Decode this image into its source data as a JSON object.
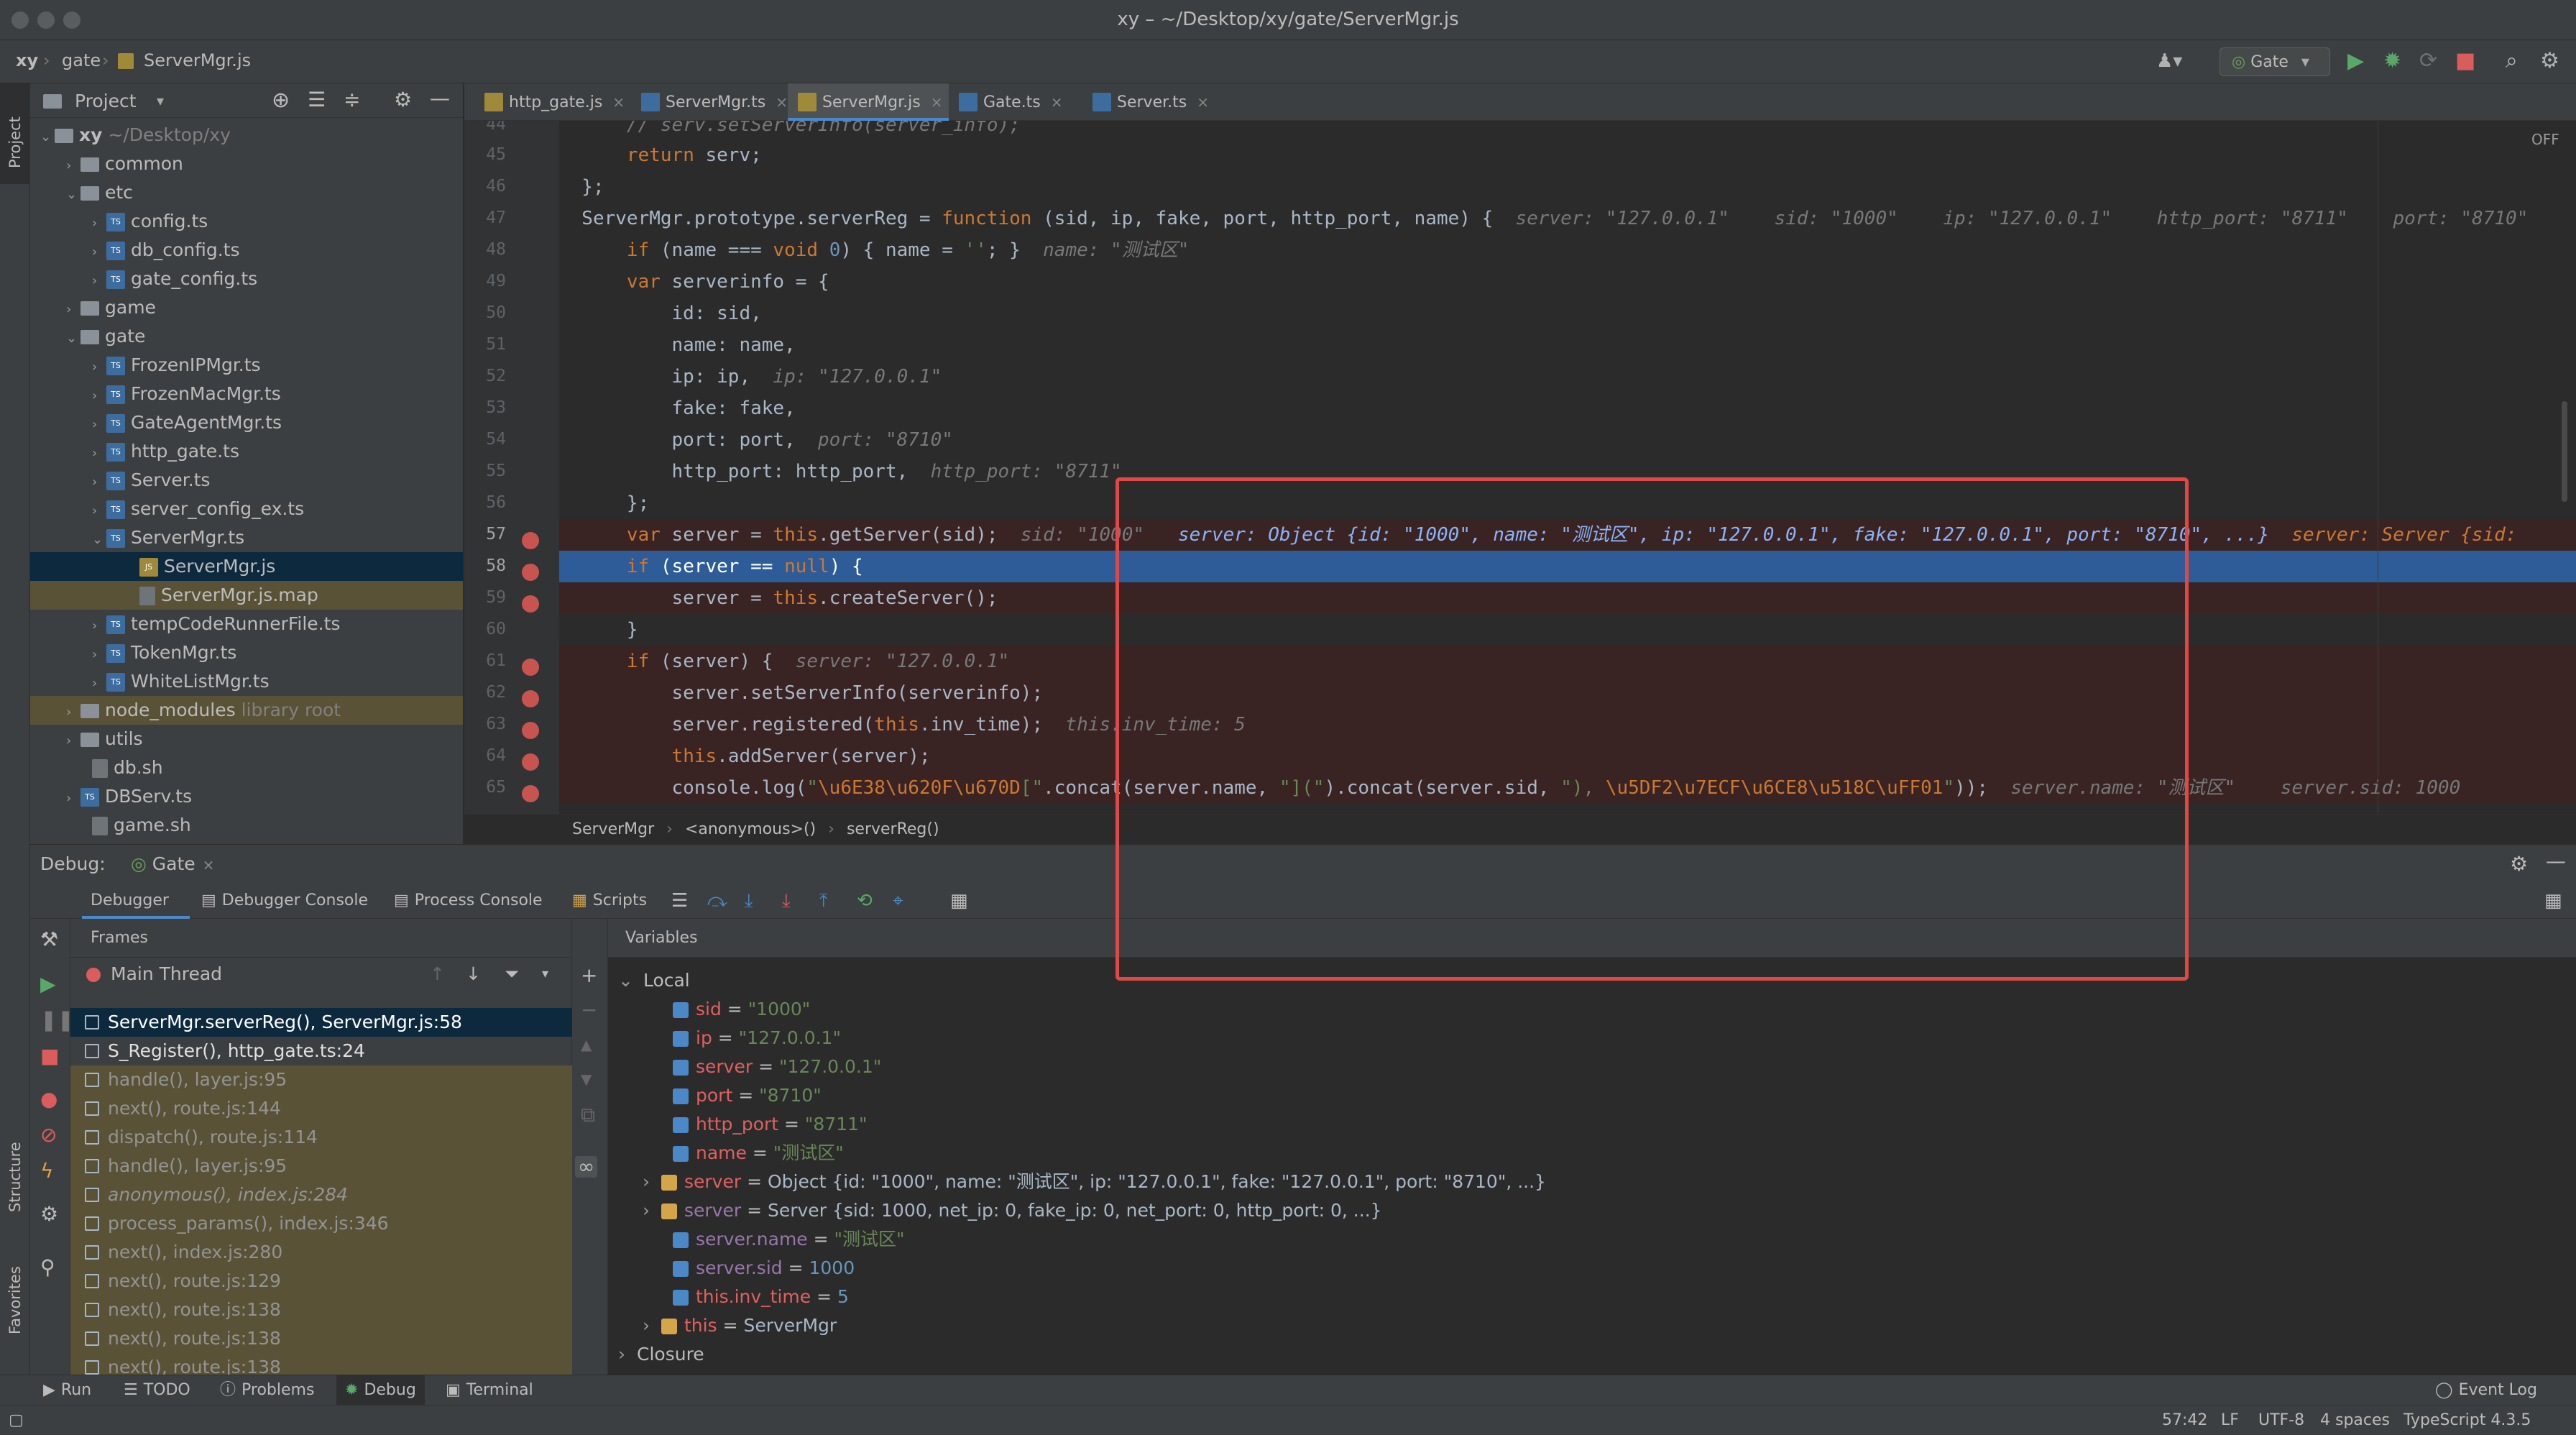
{
  "window": {
    "title": "xy – ~/Desktop/xy/gate/ServerMgr.js"
  },
  "nav": {
    "crumbs": [
      "xy",
      "gate",
      "ServerMgr.js"
    ],
    "run_config": "Gate"
  },
  "left_stripe": {
    "project": "Project",
    "structure": "Structure",
    "favorites": "Favorites"
  },
  "project": {
    "title": "Project",
    "rows": [
      {
        "label": "xy",
        "hint": "~/Desktop/xy"
      },
      {
        "label": "common"
      },
      {
        "label": "etc"
      },
      {
        "label": "config.ts"
      },
      {
        "label": "db_config.ts"
      },
      {
        "label": "gate_config.ts"
      },
      {
        "label": "game"
      },
      {
        "label": "gate"
      },
      {
        "label": "FrozenIPMgr.ts"
      },
      {
        "label": "FrozenMacMgr.ts"
      },
      {
        "label": "GateAgentMgr.ts"
      },
      {
        "label": "http_gate.ts"
      },
      {
        "label": "Server.ts"
      },
      {
        "label": "server_config_ex.ts"
      },
      {
        "label": "ServerMgr.ts"
      },
      {
        "label": "ServerMgr.js"
      },
      {
        "label": "ServerMgr.js.map"
      },
      {
        "label": "tempCodeRunnerFile.ts"
      },
      {
        "label": "TokenMgr.ts"
      },
      {
        "label": "WhiteListMgr.ts"
      },
      {
        "label": "node_modules",
        "hint": "library root"
      },
      {
        "label": "utils"
      },
      {
        "label": "db.sh"
      },
      {
        "label": "DBServ.ts"
      },
      {
        "label": "game.sh"
      }
    ]
  },
  "editor": {
    "tabs": [
      "http_gate.js",
      "ServerMgr.ts",
      "ServerMgr.js",
      "Gate.ts",
      "Server.ts"
    ],
    "off_label": "OFF",
    "line_numbers": [
      "44",
      "45",
      "46",
      "47",
      "48",
      "49",
      "50",
      "51",
      "52",
      "53",
      "54",
      "55",
      "56",
      "57",
      "58",
      "59",
      "60",
      "61",
      "62",
      "63",
      "64",
      "65"
    ],
    "inline": {
      "l47": "server: \"127.0.0.1\"    sid: \"1000\"    ip: \"127.0.0.1\"    http_port: \"8711\"    port: \"8710\"",
      "l48": "name: \"测试区\"",
      "l52": "ip: \"127.0.0.1\"",
      "l54": "port: \"8710\"",
      "l55": "http_port: \"8711\"",
      "l57a": "sid: \"1000\"",
      "l57b": "server: Object {id: \"1000\", name: \"测试区\", ip: \"127.0.0.1\", fake: \"127.0.0.1\", port: \"8710\", ...}",
      "l57c": "server: Server {sid:",
      "l61": "server: \"127.0.0.1\"",
      "l63": "this.inv_time: 5",
      "l65": "server.name: \"测试区\"    server.sid: 1000"
    },
    "breadcrumbs": [
      "ServerMgr",
      "<anonymous>()",
      "serverReg()"
    ]
  },
  "debug": {
    "label": "Debug:",
    "session": "Gate",
    "tabs": [
      "Debugger",
      "Debugger Console",
      "Process Console",
      "Scripts"
    ],
    "frames_title": "Frames",
    "thread": "Main Thread",
    "frames": [
      {
        "text": "ServerMgr.serverReg(), ServerMgr.js:58",
        "kind": "sel"
      },
      {
        "text": "S_Register(), http_gate.ts:24",
        "kind": "user"
      },
      {
        "text": "handle(), layer.js:95",
        "kind": "lib"
      },
      {
        "text": "next(), route.js:144",
        "kind": "lib"
      },
      {
        "text": "dispatch(), route.js:114",
        "kind": "lib"
      },
      {
        "text": "handle(), layer.js:95",
        "kind": "lib"
      },
      {
        "text": "anonymous(), index.js:284",
        "kind": "lib"
      },
      {
        "text": "process_params(), index.js:346",
        "kind": "lib"
      },
      {
        "text": "next(), index.js:280",
        "kind": "lib"
      },
      {
        "text": "next(), route.js:129",
        "kind": "lib"
      },
      {
        "text": "next(), route.js:138",
        "kind": "lib"
      },
      {
        "text": "next(), route.js:138",
        "kind": "lib"
      },
      {
        "text": "next(), route.js:138",
        "kind": "lib"
      }
    ],
    "variables_title": "Variables",
    "local_label": "Local",
    "closure_label": "Closure",
    "vars": {
      "sid": {
        "name": "sid",
        "value": "\"1000\""
      },
      "ip": {
        "name": "ip",
        "value": "\"127.0.0.1\""
      },
      "server_str": {
        "name": "server",
        "value": "\"127.0.0.1\""
      },
      "port": {
        "name": "port",
        "value": "\"8710\""
      },
      "http_port": {
        "name": "http_port",
        "value": "\"8711\""
      },
      "name": {
        "name": "name",
        "value": "\"测试区\""
      },
      "server_obj": {
        "name": "server",
        "value": "Object {id: \"1000\", name: \"测试区\", ip: \"127.0.0.1\", fake: \"127.0.0.1\", port: \"8710\", ...}"
      },
      "server_srv": {
        "name": "server",
        "value": "Server {sid: 1000, net_ip: 0, fake_ip: 0, net_port: 0, http_port: 0, ...}"
      },
      "server_name": {
        "name": "server.name",
        "value": "\"测试区\""
      },
      "server_sid": {
        "name": "server.sid",
        "value": "1000"
      },
      "inv_time": {
        "name": "this.inv_time",
        "value": "5"
      },
      "this": {
        "name": "this",
        "value": "ServerMgr"
      }
    }
  },
  "bottom": {
    "tabs": [
      "Run",
      "TODO",
      "Problems",
      "Debug",
      "Terminal"
    ],
    "event_log": "Event Log"
  },
  "status": {
    "position": "57:42",
    "line_sep": "LF",
    "encoding": "UTF-8",
    "indent": "4 spaces",
    "lang": "TypeScript 4.3.5"
  }
}
